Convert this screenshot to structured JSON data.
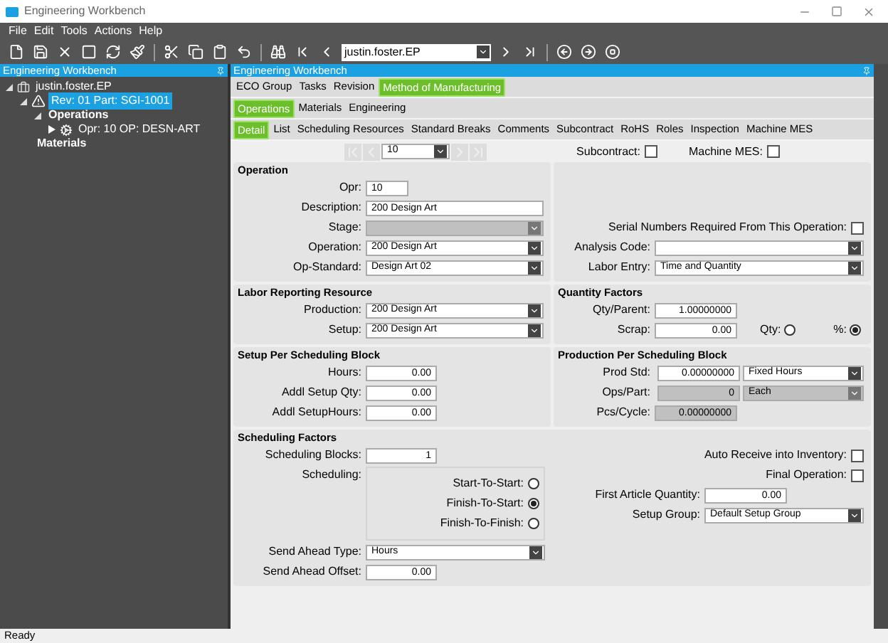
{
  "window": {
    "title": "Engineering Workbench"
  },
  "menu": [
    "File",
    "Edit",
    "Tools",
    "Actions",
    "Help"
  ],
  "toolbar": {
    "user_value": "justin.foster.EP"
  },
  "left_panel": {
    "title": "Engineering Workbench",
    "tree": [
      {
        "label": "justin.foster.EP",
        "kind": "folder",
        "expanded": true,
        "selected": false,
        "children": [
          {
            "label": "Rev: 01 Part: SGI-1001",
            "kind": "part",
            "expanded": true,
            "selected": true,
            "children": [
              {
                "label": "Operations",
                "kind": "group",
                "expanded": true,
                "selected": false,
                "children": [
                  {
                    "label": "Opr: 10 OP: DESN-ART",
                    "kind": "operation",
                    "expanded": false,
                    "selected": false
                  }
                ]
              },
              {
                "label": "Materials",
                "kind": "group",
                "selected": false
              }
            ]
          }
        ]
      }
    ]
  },
  "main": {
    "title": "Engineering Workbench",
    "tab_rows": [
      [
        {
          "label": "ECO Group",
          "selected": false
        },
        {
          "label": "Tasks",
          "selected": false
        },
        {
          "label": "Revision",
          "selected": false
        },
        {
          "label": "Method of Manufacturing",
          "selected": true
        }
      ],
      [
        {
          "label": "Operations",
          "selected": true
        },
        {
          "label": "Materials",
          "selected": false
        },
        {
          "label": "Engineering",
          "selected": false
        }
      ],
      [
        {
          "label": "Detail",
          "selected": true
        },
        {
          "label": "List",
          "selected": false
        },
        {
          "label": "Scheduling Resources",
          "selected": false
        },
        {
          "label": "Standard Breaks",
          "selected": false
        },
        {
          "label": "Comments",
          "selected": false
        },
        {
          "label": "Subcontract",
          "selected": false
        },
        {
          "label": "RoHS",
          "selected": false
        },
        {
          "label": "Roles",
          "selected": false
        },
        {
          "label": "Inspection",
          "selected": false
        },
        {
          "label": "Machine MES",
          "selected": false
        }
      ]
    ],
    "nav": {
      "record": "10",
      "checks": [
        {
          "label": "Subcontract:",
          "checked": false
        },
        {
          "label": "Machine MES:",
          "checked": false
        }
      ]
    },
    "panel_rows": [
      [
        {
          "title": "Operation",
          "columns": [
            [
              {
                "kind": "code",
                "label": "Opr:",
                "value": "10"
              },
              {
                "kind": "text",
                "label": "Description:",
                "value": "200 Design Art"
              },
              {
                "kind": "select",
                "label": "Stage:",
                "disabled": true
              },
              {
                "kind": "select",
                "label": "Operation:",
                "value": "200 Design Art",
                "disabled": false
              },
              {
                "kind": "select",
                "label": "Op-Standard:",
                "value": "Design Art 02",
                "disabled": false
              }
            ]
          ]
        },
        {
          "columns": [
            [
              {
                "kind": "checkbox",
                "label": "Serial Numbers Required From This Operation:",
                "checked": false
              },
              {
                "kind": "select",
                "label": "Analysis Code:",
                "disabled": false
              },
              {
                "kind": "select",
                "label": "Labor Entry:",
                "value": "Time and Quantity",
                "disabled": false
              }
            ]
          ]
        }
      ],
      [
        {
          "title": "Labor Reporting Resource",
          "columns": [
            [
              {
                "kind": "select",
                "label": "Production:",
                "value": "200 Design Art",
                "disabled": false
              },
              {
                "kind": "select",
                "label": "Setup:",
                "value": "200 Design Art",
                "disabled": false
              }
            ]
          ]
        },
        {
          "title": "Quantity Factors",
          "columns": [
            [
              {
                "kind": "number",
                "label": "Qty/Parent:",
                "value": "1.00000000",
                "disabled": false
              },
              {
                "kind": "number-radios",
                "label": "Scrap:",
                "value": "0.00",
                "options": [
                  {
                    "label": "Qty:",
                    "selected": false
                  },
                  {
                    "label": "%:",
                    "selected": true
                  }
                ]
              }
            ]
          ]
        }
      ],
      [
        {
          "title": "Setup Per Scheduling Block",
          "columns": [
            [
              {
                "kind": "number",
                "label": "Hours:",
                "value": "0.00",
                "disabled": false
              },
              {
                "kind": "number",
                "label": "Addl Setup Qty:",
                "value": "0.00",
                "disabled": false
              },
              {
                "kind": "number",
                "label": "Addl SetupHours:",
                "value": "0.00",
                "disabled": false
              }
            ]
          ]
        },
        {
          "title": "Production Per Scheduling Block",
          "columns": [
            [
              {
                "kind": "number-select",
                "label": "Prod Std:",
                "value": "0.00000000",
                "option": "Fixed Hours",
                "disabled": false
              },
              {
                "kind": "number-select",
                "label": "Ops/Part:",
                "value": "0",
                "option": "Each",
                "disabled": true
              },
              {
                "kind": "number",
                "label": "Pcs/Cycle:",
                "value": "0.00000000",
                "disabled": true
              }
            ]
          ]
        }
      ],
      [
        {
          "title": "Scheduling Factors",
          "columns": [
            [
              {
                "kind": "number",
                "label": "Scheduling Blocks:",
                "value": "1",
                "disabled": false
              },
              {
                "kind": "radios",
                "label": "Scheduling:",
                "options": [
                  {
                    "label": "Start-To-Start:",
                    "selected": false
                  },
                  {
                    "label": "Finish-To-Start:",
                    "selected": true
                  },
                  {
                    "label": "Finish-To-Finish:",
                    "selected": false
                  }
                ]
              },
              {
                "kind": "select",
                "label": "Send Ahead Type:",
                "value": "Hours",
                "disabled": false
              },
              {
                "kind": "number",
                "label": "Send Ahead Offset:",
                "value": "0.00",
                "disabled": false
              }
            ],
            [
              {
                "kind": "checkbox",
                "label": "Auto Receive into Inventory:",
                "checked": false
              },
              {
                "kind": "checkbox",
                "label": "Final Operation:",
                "checked": false
              },
              {
                "kind": "number",
                "label": "First Article Quantity:",
                "value": "0.00",
                "disabled": false
              },
              {
                "kind": "select",
                "label": "Setup Group:",
                "value": "Default Setup Group",
                "disabled": false
              }
            ]
          ]
        }
      ]
    ]
  },
  "status_bar": "Ready"
}
